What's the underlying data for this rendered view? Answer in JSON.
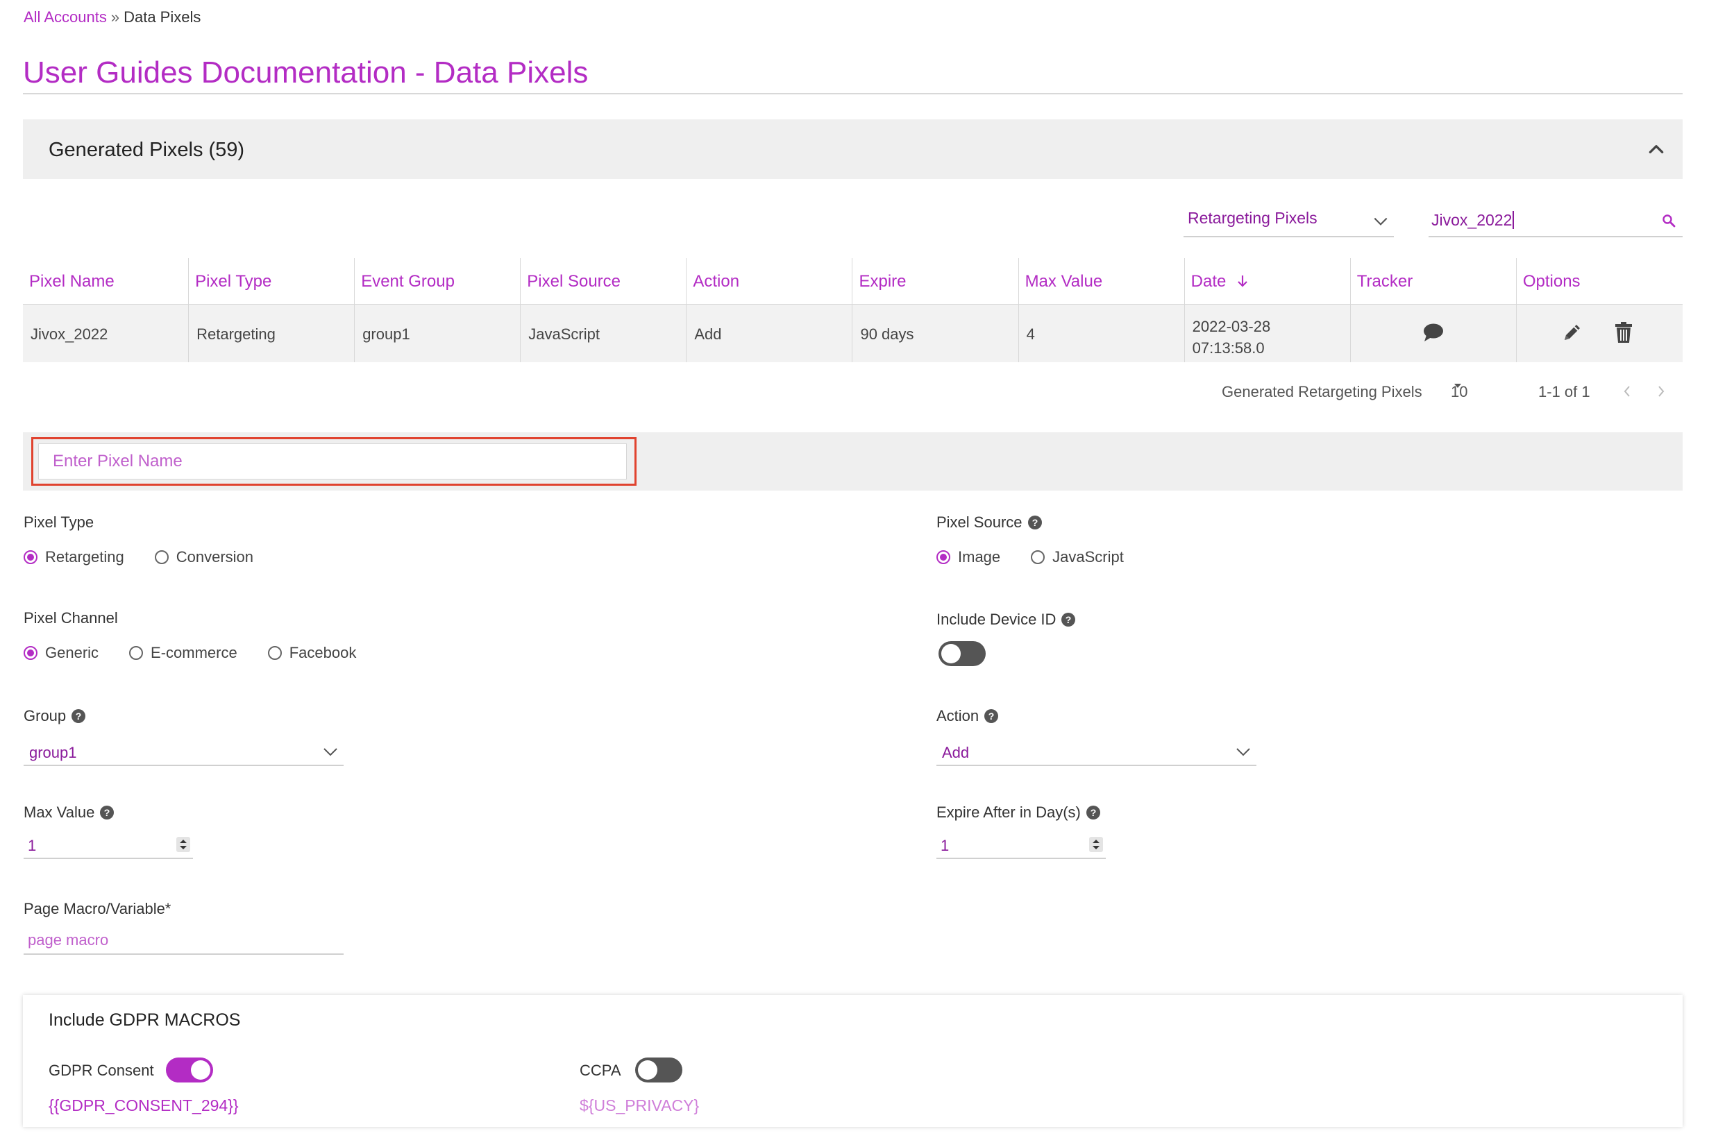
{
  "breadcrumb": {
    "root": "All Accounts",
    "separator": "»",
    "current": "Data Pixels"
  },
  "page_title": "User Guides Documentation - Data Pixels",
  "generated": {
    "label": "Generated Pixels (59)",
    "collapse_icon": "chevron-up-icon"
  },
  "filter": {
    "selected": "Retargeting Pixels"
  },
  "search": {
    "value": "Jivox_2022",
    "icon": "search-icon"
  },
  "table": {
    "columns": [
      "Pixel Name",
      "Pixel Type",
      "Event Group",
      "Pixel Source",
      "Action",
      "Expire",
      "Max Value",
      "Date",
      "Tracker",
      "Options"
    ],
    "sort_column": "Date",
    "sort_direction": "descending",
    "rows": [
      {
        "pixel_name": "Jivox_2022",
        "pixel_type": "Retargeting",
        "event_group": "group1",
        "pixel_source": "JavaScript",
        "action": "Add",
        "expire": "90 days",
        "max_value": "4",
        "date_line1": "2022-03-28",
        "date_line2": "07:13:58.0",
        "tracker_icon": "comment-icon",
        "options_icons": [
          "pencil-icon",
          "trash-icon"
        ]
      }
    ]
  },
  "pagination": {
    "label": "Generated Retargeting Pixels",
    "page_size": "10",
    "range": "1-1 of 1"
  },
  "form": {
    "name_placeholder": "Enter Pixel Name",
    "pixel_type": {
      "label": "Pixel Type",
      "options": [
        "Retargeting",
        "Conversion"
      ],
      "selected": "Retargeting"
    },
    "pixel_source": {
      "label": "Pixel Source",
      "options": [
        "Image",
        "JavaScript"
      ],
      "selected": "Image"
    },
    "pixel_channel": {
      "label": "Pixel Channel",
      "options": [
        "Generic",
        "E-commerce",
        "Facebook"
      ],
      "selected": "Generic"
    },
    "include_device_id": {
      "label": "Include Device ID",
      "on": false
    },
    "group": {
      "label": "Group",
      "value": "group1"
    },
    "action": {
      "label": "Action",
      "value": "Add"
    },
    "max_value": {
      "label": "Max Value",
      "value": "1"
    },
    "expire_after": {
      "label": "Expire After in Day(s)",
      "value": "1"
    },
    "page_macro": {
      "label": "Page Macro/Variable*",
      "placeholder": "page macro"
    }
  },
  "gdpr": {
    "title": "Include GDPR MACROS",
    "consent": {
      "label": "GDPR Consent",
      "on": true,
      "macro": "{{GDPR_CONSENT_294}}"
    },
    "ccpa": {
      "label": "CCPA",
      "on": false,
      "macro": "${US_PRIVACY}"
    }
  },
  "colors": {
    "accent": "#b32cc4",
    "highlight": "#e0432f",
    "panel": "#efefef"
  }
}
